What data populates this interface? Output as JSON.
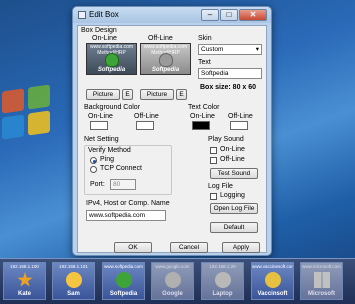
{
  "window": {
    "title": "Edit Box",
    "minimize": "–",
    "maximize": "□",
    "close": "✕"
  },
  "box_design": {
    "legend": "Box Design",
    "online_label": "On-Line",
    "offline_label": "Off-Line",
    "preview_caption": "Softpedia",
    "preview_url": "www.softpedia.com",
    "preview_sub": "Method/HRP",
    "picture_label": "Picture",
    "e_label": "E",
    "skin_label": "Skin",
    "skin_value": "Custom",
    "text_label": "Text",
    "text_value": "Softpedia",
    "box_size": "Box size: 80 x 60"
  },
  "background_color": {
    "legend": "Background Color",
    "online": "On-Line",
    "offline": "Off-Line",
    "online_color": "#ffffff",
    "offline_color": "#ffffff"
  },
  "text_color": {
    "legend": "Text Color",
    "online": "On-Line",
    "offline": "Off-Line",
    "online_color": "#000000",
    "offline_color": "#ffffff"
  },
  "net_setting": {
    "legend": "Net Setting",
    "verify_label": "Verify Method",
    "ping": "Ping",
    "tcp": "TCP Connect",
    "port_label": "Port:",
    "port_value": "80",
    "ipv4_label": "IPv4, Host or Comp. Name",
    "host_value": "www.softpedia.com"
  },
  "play_sound": {
    "legend": "Play Sound",
    "online": "On-Line",
    "offline": "Off-Line",
    "test": "Test Sound"
  },
  "log_file": {
    "legend": "Log File",
    "logging": "Logging",
    "open": "Open Log File"
  },
  "buttons": {
    "default": "Default",
    "ok": "OK",
    "cancel": "Cancel",
    "apply": "Apply"
  },
  "taskbar_tiles": [
    {
      "header": "192.168.1.100",
      "name": "Kate",
      "icon": "star-icon",
      "color": "#f0a020"
    },
    {
      "header": "192.168.1.101",
      "name": "Sam",
      "icon": "smiley-icon",
      "color": "#f5c542"
    },
    {
      "header": "www.softpedia.com",
      "name": "Softpedia",
      "icon": "frog-icon",
      "color": "#3ea437"
    },
    {
      "header": "www.google.com",
      "name": "Google",
      "icon": "globe-icon",
      "color": "#b0b0b0"
    },
    {
      "header": "192.168.1.20",
      "name": "Laptop",
      "icon": "laptop-icon",
      "color": "#b8b8b8"
    },
    {
      "header": "www.vaccinesoft.com",
      "name": "Vaccinsoft",
      "icon": "smiley-icon",
      "color": "#e6c040"
    },
    {
      "header": "www.microsoft.com",
      "name": "Microsoft",
      "icon": "windows-icon",
      "color": "#c0c0c0"
    }
  ]
}
